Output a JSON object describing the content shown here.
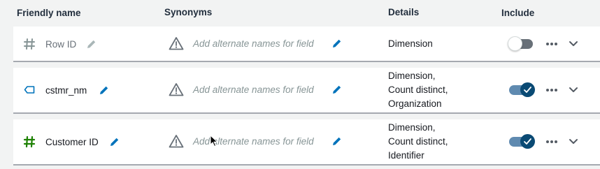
{
  "header": {
    "friendly_name": "Friendly name",
    "synonyms": "Synonyms",
    "details": "Details",
    "include": "Include"
  },
  "rows": [
    {
      "type_icon": "hash-icon",
      "type_color": "#879596",
      "name": "Row ID",
      "synonyms_placeholder": "Add alternate names for field",
      "details": [
        "Dimension"
      ],
      "include": false
    },
    {
      "type_icon": "tag-icon",
      "type_color": "#0073bb",
      "name": "cstmr_nm",
      "synonyms_placeholder": "Add alternate names for field",
      "details": [
        "Dimension,",
        "Count distinct,",
        "Organization"
      ],
      "include": true
    },
    {
      "type_icon": "hash-icon",
      "type_color": "#1d8102",
      "name": "Customer ID",
      "synonyms_placeholder": "Add alternate names for field",
      "details": [
        "Dimension,",
        "Count distinct,",
        "Identifier"
      ],
      "include": true
    }
  ],
  "colors": {
    "accent": "#0073bb",
    "toggle_on": "#0a4a74",
    "row_border": "#a5a9b0"
  }
}
